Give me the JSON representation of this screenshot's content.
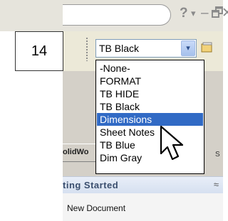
{
  "number_label": "14",
  "window_controls": {
    "help": "?",
    "dropdown": "▾",
    "minimize": "–",
    "restore": "🗗",
    "close": "✕"
  },
  "layer_combo": {
    "value": "TB Black",
    "arrow": "▾"
  },
  "dropdown_items": [
    "-None-",
    "FORMAT",
    "TB HIDE",
    "TB Black",
    "Dimensions",
    "Sheet Notes",
    "TB Blue",
    "Dim Gray"
  ],
  "selected_item": "Dimensions",
  "task_pane": {
    "tab_label": "olidWo",
    "right_mark": "S",
    "section_title": "ting Started",
    "collapse_icon": "≈",
    "link_new_document": "New Document"
  },
  "colors": {
    "selection_bg": "#316ac5",
    "toolbar_bg": "#ece9d8",
    "combo_border": "#7f9db9",
    "section_text": "#3a4e6e"
  }
}
